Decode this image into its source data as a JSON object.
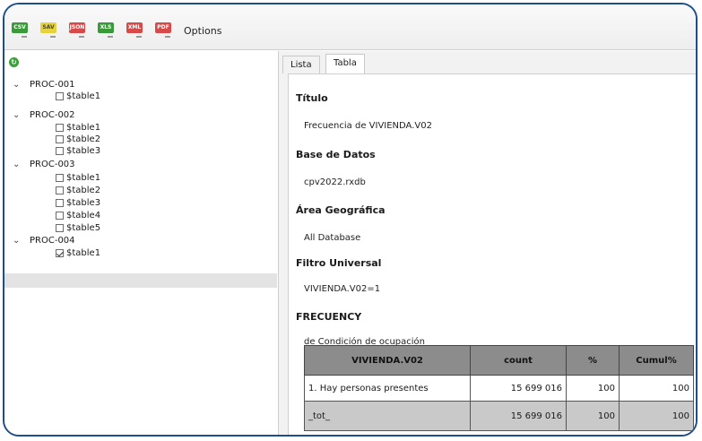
{
  "toolbar": {
    "buttons": [
      {
        "label": "CSV",
        "color": "#3a9a3a",
        "icon": "csv-export-icon"
      },
      {
        "label": "SAV",
        "color": "#e6d23a",
        "icon": "sav-export-icon"
      },
      {
        "label": "JSON",
        "color": "#d84a4a",
        "icon": "json-export-icon"
      },
      {
        "label": "XLS",
        "color": "#3a9a3a",
        "icon": "xls-export-icon"
      },
      {
        "label": "XML",
        "color": "#d84a4a",
        "icon": "xml-export-icon"
      },
      {
        "label": "PDF",
        "color": "#d84a4a",
        "icon": "pdf-export-icon"
      }
    ],
    "options_label": "Options"
  },
  "tree": {
    "procs": [
      {
        "name": "PROC-001",
        "tables": [
          {
            "label": "$table1",
            "checked": false
          }
        ]
      },
      {
        "name": "PROC-002",
        "tables": [
          {
            "label": "$table1",
            "checked": false
          },
          {
            "label": "$table2",
            "checked": false
          },
          {
            "label": "$table3",
            "checked": false
          }
        ]
      },
      {
        "name": "PROC-003",
        "tables": [
          {
            "label": "$table1",
            "checked": false
          },
          {
            "label": "$table2",
            "checked": false
          },
          {
            "label": "$table3",
            "checked": false
          },
          {
            "label": "$table4",
            "checked": false
          },
          {
            "label": "$table5",
            "checked": false
          }
        ]
      },
      {
        "name": "PROC-004",
        "tables": [
          {
            "label": "$table1",
            "checked": true
          }
        ]
      }
    ]
  },
  "tabs": [
    {
      "label": "Lista",
      "active": false
    },
    {
      "label": "Tabla",
      "active": true
    }
  ],
  "report": {
    "titulo_label": "Título",
    "titulo_value": "Frecuencia de VIVIENDA.V02",
    "base_label": "Base de Datos",
    "base_value": "cpv2022.rxdb",
    "area_label": "Área Geográfica",
    "area_value": "All Database",
    "filtro_label": "Filtro Universal",
    "filtro_value": "VIVIENDA.V02=1",
    "frecuency_label": "FRECUENCY",
    "frecuency_value": "de Condición de ocupación",
    "table": {
      "headers": [
        "VIVIENDA.V02",
        "count",
        "%",
        "Cumul%"
      ],
      "rows": [
        [
          "1. Hay personas presentes",
          "15 699 016",
          "100",
          "100"
        ],
        [
          "_tot_",
          "15 699 016",
          "100",
          "100"
        ]
      ]
    }
  }
}
